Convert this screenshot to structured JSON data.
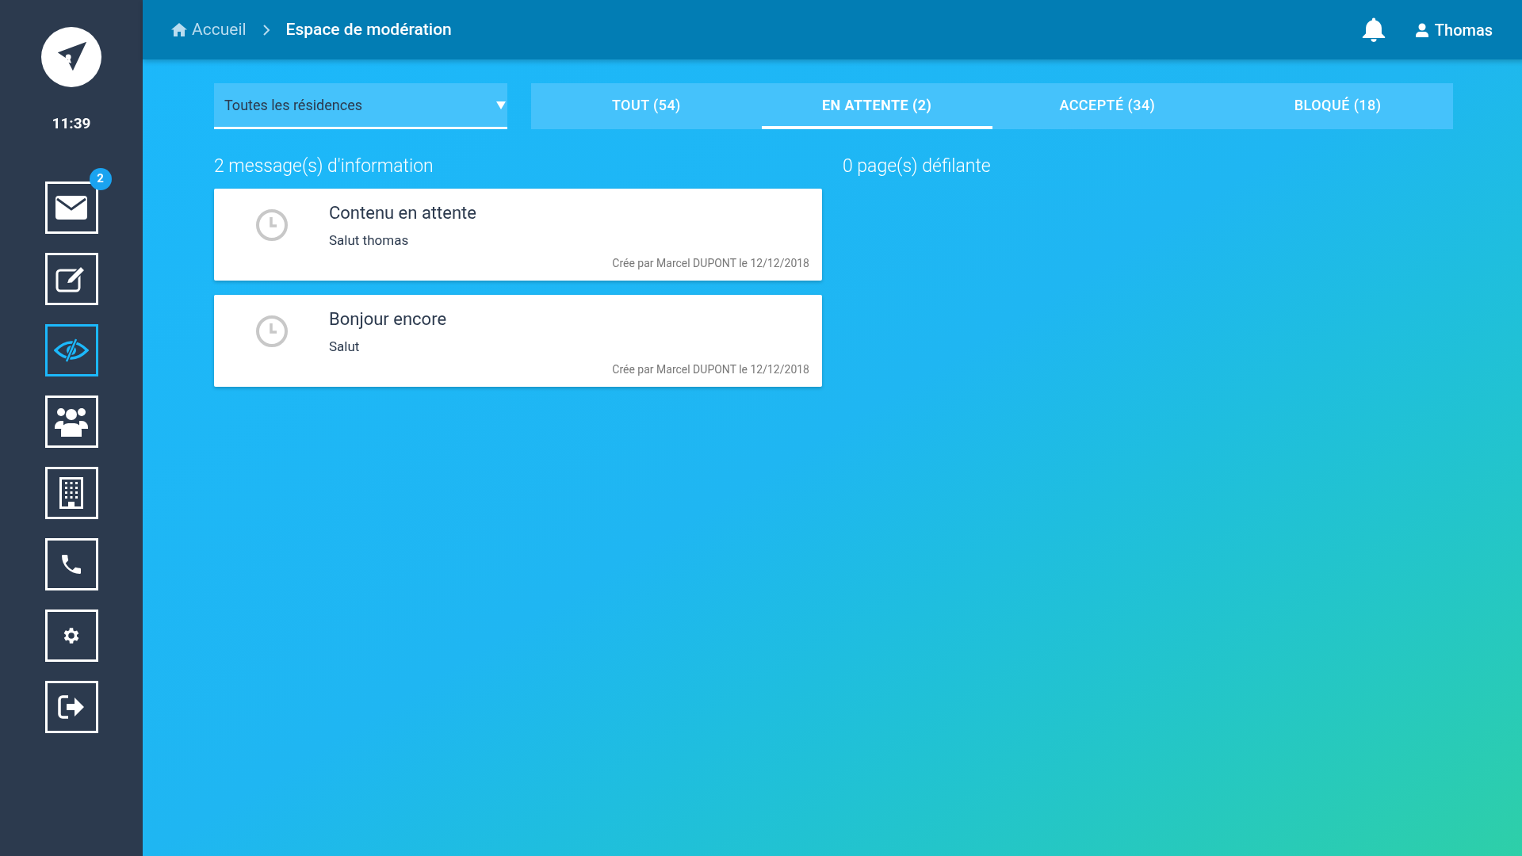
{
  "sidebar": {
    "time": "11:39",
    "items": [
      {
        "kind": "envelope",
        "selected": false,
        "badge": "2"
      },
      {
        "kind": "edit",
        "selected": false
      },
      {
        "kind": "eye-slash",
        "selected": true
      },
      {
        "kind": "users",
        "selected": false
      },
      {
        "kind": "building",
        "selected": false
      },
      {
        "kind": "phone",
        "selected": false
      },
      {
        "kind": "gear",
        "selected": false
      },
      {
        "kind": "sign-out",
        "selected": false
      }
    ]
  },
  "header": {
    "breadcrumb": [
      {
        "label": "Accueil",
        "kind": "home"
      },
      {
        "label": "Espace de modération",
        "kind": "current"
      }
    ],
    "user": "Thomas"
  },
  "filter": {
    "value": "Toutes les résidences"
  },
  "tabs": [
    {
      "label": "TOUT (54)",
      "selected": false
    },
    {
      "label": "EN ATTENTE (2)",
      "selected": true
    },
    {
      "label": "ACCEPTÉ (34)",
      "selected": false
    },
    {
      "label": "BLOQUÉ (18)",
      "selected": false
    }
  ],
  "messages": {
    "heading": "2 message(s) d'information",
    "items": [
      {
        "title": "Contenu en attente",
        "body": "Salut thomas",
        "meta": "Crée par Marcel DUPONT le 12/12/2018"
      },
      {
        "title": "Bonjour encore",
        "body": "Salut",
        "meta": "Crée par Marcel DUPONT le 12/12/2018"
      }
    ]
  },
  "pages": {
    "heading": "0 page(s) défilante"
  }
}
